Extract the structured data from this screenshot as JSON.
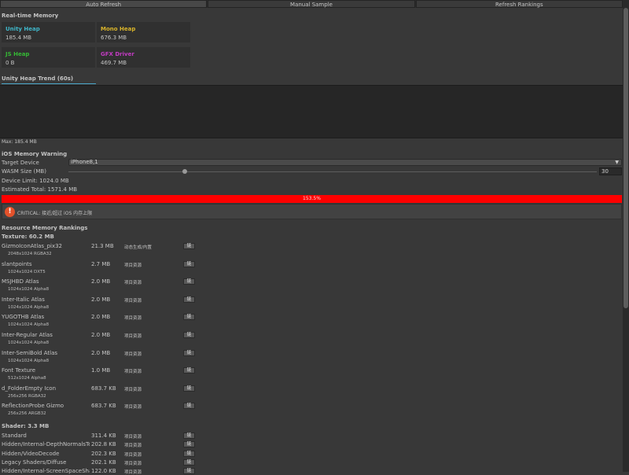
{
  "toolbar": {
    "buttons": [
      "Auto Refresh",
      "Manual Sample",
      "Refresh Rankings"
    ]
  },
  "realtime": {
    "title": "Real-time Memory",
    "cards": [
      {
        "label": "Unity Heap",
        "value": "185.4 MB",
        "color": "#3fb6c9"
      },
      {
        "label": "Mono Heap",
        "value": "676.3 MB",
        "color": "#d9b42a"
      },
      {
        "label": "JS Heap",
        "value": "0 B",
        "color": "#35b835"
      },
      {
        "label": "GFX Driver",
        "value": "469.7 MB",
        "color": "#c23bc2"
      }
    ]
  },
  "trend": {
    "title": "Unity Heap Trend (60s)",
    "max_label": "Max: 185.4 MB"
  },
  "ios": {
    "title": "iOS Memory Warning",
    "target_device_label": "Target Device",
    "target_device_value": "iPhone8,1",
    "wasm_label": "WASM Size (MB)",
    "wasm_value": "30",
    "wasm_fraction": 0.22,
    "device_limit": "Device Limit: 1024.0 MB",
    "estimated_total": "Estimated Total: 1571.4 MB",
    "progress_label": "153.5%",
    "progress_color": "#ff0000",
    "warning_icon": "!",
    "warning_text": "CRITICAL: 接近/超过 iOS 内存上限"
  },
  "rankings": {
    "title": "Resource Memory Rankings",
    "button_label": "链",
    "texture_header": "Texture: 60.2 MB",
    "textures": [
      {
        "name": "GizmoIconAtlas_pix32",
        "size": "21.3 MB",
        "tag": "动态生成/内置",
        "sub": "2048x1024 RGBA32"
      },
      {
        "name": "slantpoints",
        "size": "2.7 MB",
        "tag": "项目资源",
        "sub": "1024x1024 DXT5"
      },
      {
        "name": "MSJHBD Atlas",
        "size": "2.0 MB",
        "tag": "项目资源",
        "sub": "1024x1024 Alpha8"
      },
      {
        "name": "Inter-Italic Atlas",
        "size": "2.0 MB",
        "tag": "项目资源",
        "sub": "1024x1024 Alpha8"
      },
      {
        "name": "YUGOTHB Atlas",
        "size": "2.0 MB",
        "tag": "项目资源",
        "sub": "1024x1024 Alpha8"
      },
      {
        "name": "Inter-Regular Atlas",
        "size": "2.0 MB",
        "tag": "项目资源",
        "sub": "1024x1024 Alpha8"
      },
      {
        "name": "Inter-SemiBold Atlas",
        "size": "2.0 MB",
        "tag": "项目资源",
        "sub": "1024x1024 Alpha8"
      },
      {
        "name": "Font Texture",
        "size": "1.0 MB",
        "tag": "项目资源",
        "sub": "512x1024 Alpha8"
      },
      {
        "name": "d_FolderEmpty Icon",
        "size": "683.7 KB",
        "tag": "项目资源",
        "sub": "256x256 RGBA32"
      },
      {
        "name": "ReflectionProbe Gizmo",
        "size": "683.7 KB",
        "tag": "项目资源",
        "sub": "256x256 ARGB32"
      }
    ],
    "shader_header": "Shader: 3.3 MB",
    "shaders": [
      {
        "name": "Standard",
        "size": "311.4 KB",
        "tag": "项目资源"
      },
      {
        "name": "Hidden/Internal-DepthNormalsTexture",
        "size": "202.8 KB",
        "tag": "项目资源"
      },
      {
        "name": "Hidden/VideoDecode",
        "size": "202.3 KB",
        "tag": "项目资源"
      },
      {
        "name": "Legacy Shaders/Diffuse",
        "size": "202.1 KB",
        "tag": "项目资源"
      },
      {
        "name": "Hidden/Internal-ScreenSpaceShadows",
        "size": "122.0 KB",
        "tag": "项目资源"
      }
    ]
  }
}
